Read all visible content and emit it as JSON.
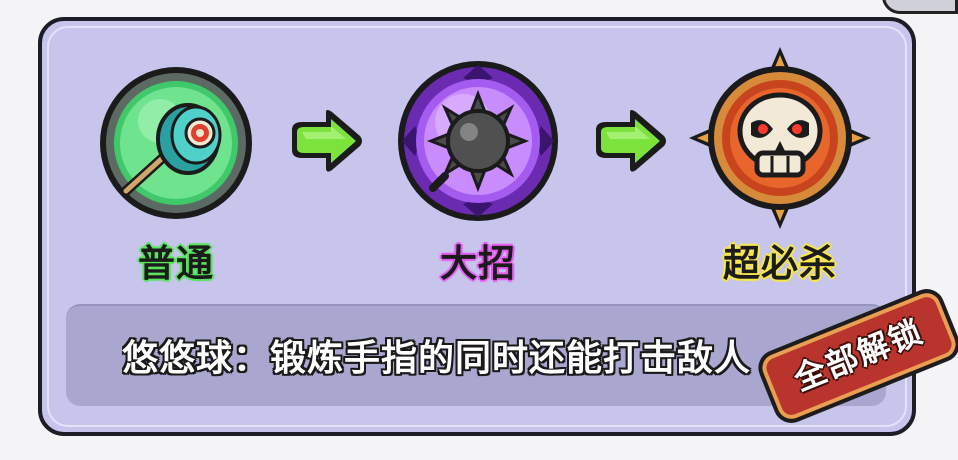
{
  "stages": [
    {
      "label": "普通",
      "icon": "yoyo-icon",
      "glow": "#59e35c"
    },
    {
      "label": "大招",
      "icon": "spiked-ball-icon",
      "glow": "#e45cf0"
    },
    {
      "label": "超必杀",
      "icon": "skull-icon",
      "glow": "#f7e84a"
    }
  ],
  "description": "悠悠球：锻炼手指的同时还能打击敌人",
  "unlock_badge": {
    "label": "全部解锁"
  },
  "colors": {
    "panel": "#c7c5ec",
    "description_box": "#a9a6cf",
    "arrow": "#7be33c",
    "badge": "#b8342c"
  }
}
